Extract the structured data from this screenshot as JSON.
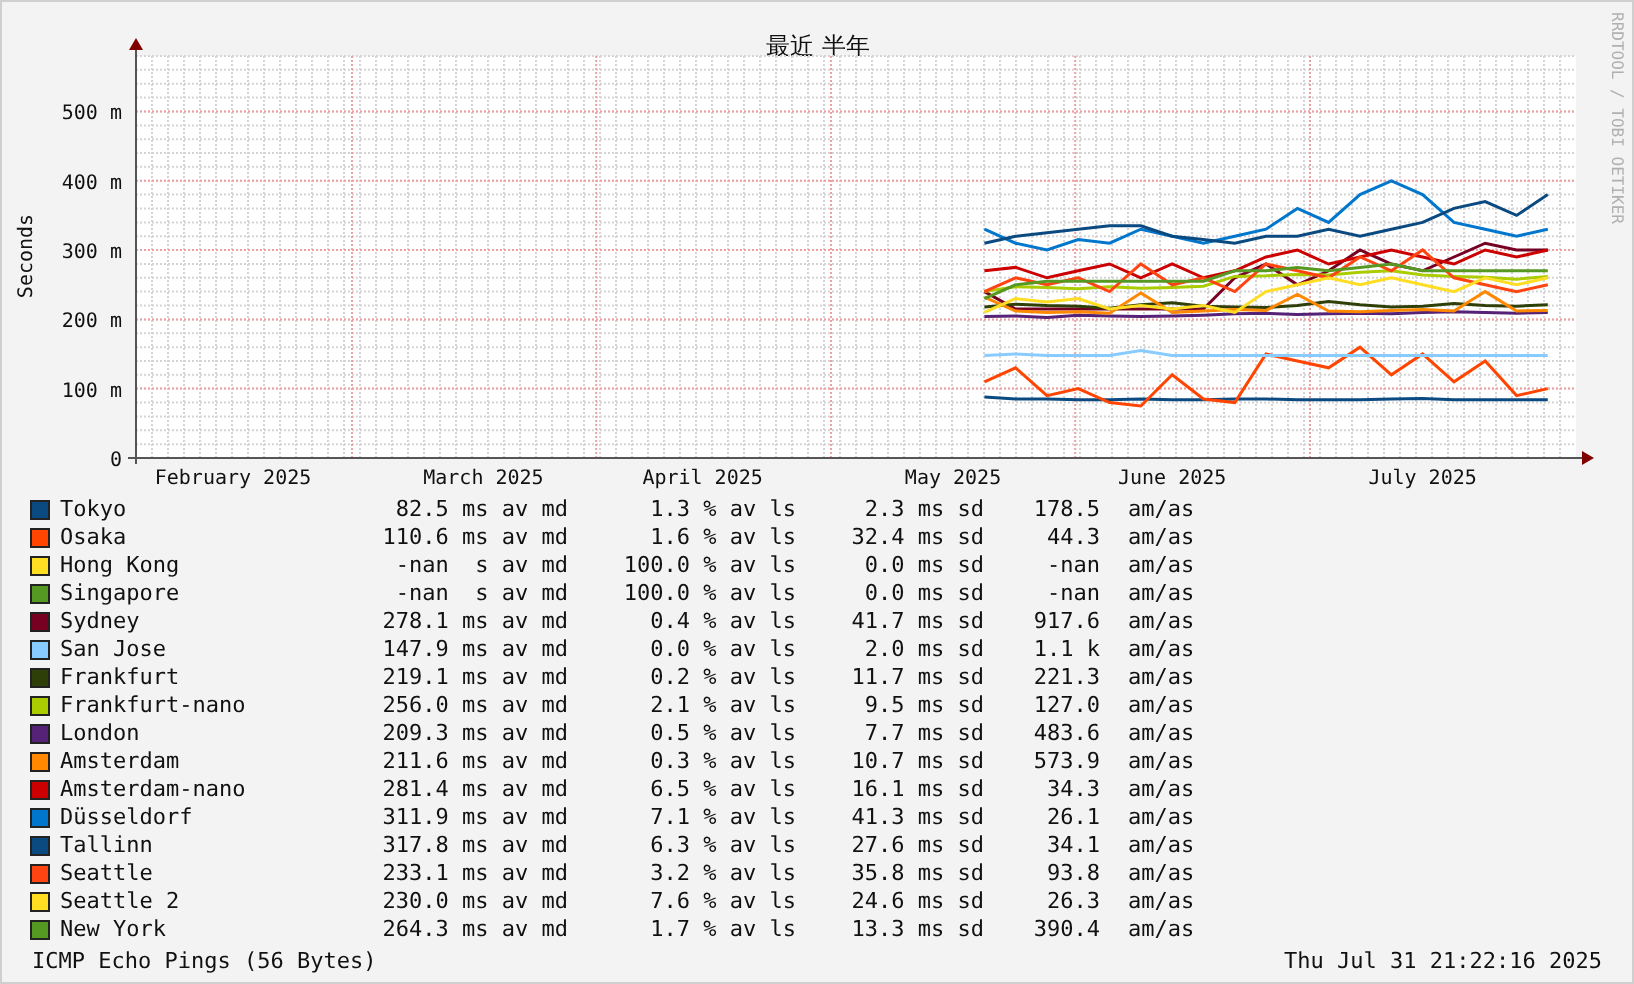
{
  "chart_data": {
    "type": "line",
    "grid": true,
    "title": "最近 半年",
    "ylabel": "Seconds",
    "ylim": [
      0,
      580
    ],
    "categories": [
      null,
      null,
      null,
      "February 2025",
      null,
      null,
      null,
      null,
      null,
      null,
      null,
      "March 2025",
      null,
      null,
      null,
      null,
      null,
      null,
      "April 2025",
      null,
      null,
      null,
      null,
      null,
      null,
      null,
      "May 2025",
      null,
      null,
      null,
      null,
      null,
      null,
      "June 2025",
      null,
      null,
      null,
      null,
      null,
      null,
      null,
      "July 2025",
      null,
      null,
      null,
      null
    ],
    "yticks": [
      {
        "value": 0,
        "label": "0"
      },
      {
        "value": 100,
        "label": "100 m"
      },
      {
        "value": 200,
        "label": "200 m"
      },
      {
        "value": 300,
        "label": "300 m"
      },
      {
        "value": 400,
        "label": "400 m"
      },
      {
        "value": 500,
        "label": "500 m"
      }
    ],
    "series": [
      {
        "name": "Tokyo",
        "color": "#0a4a80",
        "values": [
          null,
          null,
          null,
          null,
          null,
          null,
          null,
          null,
          null,
          null,
          null,
          null,
          null,
          null,
          null,
          null,
          null,
          null,
          null,
          null,
          null,
          null,
          null,
          null,
          null,
          null,
          null,
          88,
          85,
          85,
          84,
          84,
          85,
          84,
          84,
          85,
          85,
          84,
          84,
          84,
          85,
          86,
          84,
          84,
          84,
          84
        ]
      },
      {
        "name": "Osaka",
        "color": "#ff4500",
        "values": [
          null,
          null,
          null,
          null,
          null,
          null,
          null,
          null,
          null,
          null,
          null,
          null,
          null,
          null,
          null,
          null,
          null,
          null,
          null,
          null,
          null,
          null,
          null,
          null,
          null,
          null,
          null,
          110,
          130,
          90,
          100,
          80,
          75,
          120,
          85,
          80,
          150,
          140,
          130,
          160,
          120,
          150,
          110,
          140,
          90,
          100
        ]
      },
      {
        "name": "Hong Kong",
        "color": "#ffdd22",
        "values": [
          null,
          null,
          null,
          null,
          null,
          null,
          null,
          null,
          null,
          null,
          null,
          null,
          null,
          null,
          null,
          null,
          null,
          null,
          null,
          null,
          null,
          null,
          null,
          null,
          null,
          null,
          null,
          null,
          null,
          null,
          null,
          null,
          null,
          null,
          null,
          null,
          null,
          null,
          null,
          null,
          null,
          null,
          null,
          null,
          null,
          null
        ]
      },
      {
        "name": "Singapore",
        "color": "#559922",
        "values": [
          null,
          null,
          null,
          null,
          null,
          null,
          null,
          null,
          null,
          null,
          null,
          null,
          null,
          null,
          null,
          null,
          null,
          null,
          null,
          null,
          null,
          null,
          null,
          null,
          null,
          null,
          null,
          null,
          null,
          null,
          null,
          null,
          null,
          null,
          null,
          null,
          null,
          null,
          null,
          null,
          null,
          null,
          null,
          null,
          null,
          null
        ]
      },
      {
        "name": "Sydney",
        "color": "#770022",
        "values": [
          null,
          null,
          null,
          null,
          null,
          null,
          null,
          null,
          null,
          null,
          null,
          null,
          null,
          null,
          null,
          null,
          null,
          null,
          null,
          null,
          null,
          null,
          null,
          null,
          null,
          null,
          null,
          240,
          215,
          215,
          215,
          215,
          215,
          215,
          215,
          260,
          280,
          250,
          270,
          300,
          280,
          270,
          290,
          310,
          300,
          300
        ]
      },
      {
        "name": "San Jose",
        "color": "#88ccff",
        "values": [
          null,
          null,
          null,
          null,
          null,
          null,
          null,
          null,
          null,
          null,
          null,
          null,
          null,
          null,
          null,
          null,
          null,
          null,
          null,
          null,
          null,
          null,
          null,
          null,
          null,
          null,
          null,
          148,
          150,
          148,
          148,
          148,
          155,
          148,
          148,
          148,
          148,
          148,
          148,
          148,
          148,
          148,
          148,
          148,
          148,
          148
        ]
      },
      {
        "name": "Frankfurt",
        "color": "#2f3f08",
        "values": [
          null,
          null,
          null,
          null,
          null,
          null,
          null,
          null,
          null,
          null,
          null,
          null,
          null,
          null,
          null,
          null,
          null,
          null,
          null,
          null,
          null,
          null,
          null,
          null,
          null,
          null,
          null,
          218,
          222,
          220,
          219,
          216,
          221,
          224,
          219,
          218,
          217,
          220,
          226,
          221,
          218,
          219,
          223,
          220,
          219,
          221
        ]
      },
      {
        "name": "Frankfurt-nano",
        "color": "#aacc00",
        "values": [
          null,
          null,
          null,
          null,
          null,
          null,
          null,
          null,
          null,
          null,
          null,
          null,
          null,
          null,
          null,
          null,
          null,
          null,
          null,
          null,
          null,
          null,
          null,
          null,
          null,
          null,
          null,
          240,
          247,
          246,
          244,
          247,
          245,
          246,
          248,
          262,
          263,
          265,
          264,
          268,
          270,
          264,
          262,
          261,
          258,
          262
        ]
      },
      {
        "name": "London",
        "color": "#552277",
        "values": [
          null,
          null,
          null,
          null,
          null,
          null,
          null,
          null,
          null,
          null,
          null,
          null,
          null,
          null,
          null,
          null,
          null,
          null,
          null,
          null,
          null,
          null,
          null,
          null,
          null,
          null,
          null,
          204,
          205,
          203,
          206,
          205,
          204,
          205,
          206,
          208,
          209,
          207,
          208,
          209,
          208,
          210,
          211,
          210,
          209,
          210
        ]
      },
      {
        "name": "Amsterdam",
        "color": "#ff8800",
        "values": [
          null,
          null,
          null,
          null,
          null,
          null,
          null,
          null,
          null,
          null,
          null,
          null,
          null,
          null,
          null,
          null,
          null,
          null,
          null,
          null,
          null,
          null,
          null,
          null,
          null,
          null,
          null,
          232,
          212,
          210,
          211,
          209,
          238,
          210,
          212,
          214,
          213,
          236,
          212,
          211,
          213,
          214,
          212,
          240,
          212,
          213
        ]
      },
      {
        "name": "Amsterdam-nano",
        "color": "#cc0000",
        "values": [
          null,
          null,
          null,
          null,
          null,
          null,
          null,
          null,
          null,
          null,
          null,
          null,
          null,
          null,
          null,
          null,
          null,
          null,
          null,
          null,
          null,
          null,
          null,
          null,
          null,
          null,
          null,
          270,
          275,
          260,
          270,
          280,
          260,
          280,
          260,
          270,
          290,
          300,
          280,
          290,
          300,
          290,
          280,
          300,
          290,
          300
        ]
      },
      {
        "name": "Düsseldorf",
        "color": "#0077cc",
        "values": [
          null,
          null,
          null,
          null,
          null,
          null,
          null,
          null,
          null,
          null,
          null,
          null,
          null,
          null,
          null,
          null,
          null,
          null,
          null,
          null,
          null,
          null,
          null,
          null,
          null,
          null,
          null,
          330,
          310,
          300,
          315,
          310,
          330,
          320,
          310,
          320,
          330,
          360,
          340,
          380,
          400,
          380,
          340,
          330,
          320,
          330
        ]
      },
      {
        "name": "Tallinn",
        "color": "#0a4a80",
        "values": [
          null,
          null,
          null,
          null,
          null,
          null,
          null,
          null,
          null,
          null,
          null,
          null,
          null,
          null,
          null,
          null,
          null,
          null,
          null,
          null,
          null,
          null,
          null,
          null,
          null,
          null,
          null,
          310,
          320,
          325,
          330,
          335,
          335,
          320,
          315,
          310,
          320,
          320,
          330,
          320,
          330,
          340,
          360,
          370,
          350,
          380
        ]
      },
      {
        "name": "Seattle",
        "color": "#ff4411",
        "values": [
          null,
          null,
          null,
          null,
          null,
          null,
          null,
          null,
          null,
          null,
          null,
          null,
          null,
          null,
          null,
          null,
          null,
          null,
          null,
          null,
          null,
          null,
          null,
          null,
          null,
          null,
          null,
          240,
          260,
          250,
          260,
          240,
          280,
          250,
          260,
          240,
          280,
          270,
          260,
          290,
          270,
          300,
          260,
          250,
          240,
          250
        ]
      },
      {
        "name": "Seattle 2",
        "color": "#ffdd22",
        "values": [
          null,
          null,
          null,
          null,
          null,
          null,
          null,
          null,
          null,
          null,
          null,
          null,
          null,
          null,
          null,
          null,
          null,
          null,
          null,
          null,
          null,
          null,
          null,
          null,
          null,
          null,
          null,
          210,
          230,
          225,
          230,
          215,
          220,
          215,
          220,
          210,
          240,
          250,
          260,
          250,
          260,
          250,
          240,
          260,
          250,
          260
        ]
      },
      {
        "name": "New York",
        "color": "#559922",
        "values": [
          null,
          null,
          null,
          null,
          null,
          null,
          null,
          null,
          null,
          null,
          null,
          null,
          null,
          null,
          null,
          null,
          null,
          null,
          null,
          null,
          null,
          null,
          null,
          null,
          null,
          null,
          null,
          230,
          250,
          255,
          255,
          255,
          255,
          255,
          255,
          270,
          270,
          275,
          270,
          275,
          280,
          270,
          270,
          270,
          270,
          270
        ]
      }
    ]
  },
  "credit": "RRDTOOL / TOBI OETIKER",
  "legend": [
    {
      "median": "82.5 ms av md",
      "loss": "1.3 % av ls",
      "sd": "2.3 ms sd",
      "amas": "178.5",
      "unit": "am/as"
    },
    {
      "median": "110.6 ms av md",
      "loss": "1.6 % av ls",
      "sd": "32.4 ms sd",
      "amas": "44.3",
      "unit": "am/as"
    },
    {
      "median": "-nan  s av md",
      "loss": "100.0 % av ls",
      "sd": "0.0 ms sd",
      "amas": "-nan",
      "unit": "am/as"
    },
    {
      "median": "-nan  s av md",
      "loss": "100.0 % av ls",
      "sd": "0.0 ms sd",
      "amas": "-nan",
      "unit": "am/as"
    },
    {
      "median": "278.1 ms av md",
      "loss": "0.4 % av ls",
      "sd": "41.7 ms sd",
      "amas": "917.6",
      "unit": "am/as"
    },
    {
      "median": "147.9 ms av md",
      "loss": "0.0 % av ls",
      "sd": "2.0 ms sd",
      "amas": "1.1 k",
      "unit": "am/as"
    },
    {
      "median": "219.1 ms av md",
      "loss": "0.2 % av ls",
      "sd": "11.7 ms sd",
      "amas": "221.3",
      "unit": "am/as"
    },
    {
      "median": "256.0 ms av md",
      "loss": "2.1 % av ls",
      "sd": "9.5 ms sd",
      "amas": "127.0",
      "unit": "am/as"
    },
    {
      "median": "209.3 ms av md",
      "loss": "0.5 % av ls",
      "sd": "7.7 ms sd",
      "amas": "483.6",
      "unit": "am/as"
    },
    {
      "median": "211.6 ms av md",
      "loss": "0.3 % av ls",
      "sd": "10.7 ms sd",
      "amas": "573.9",
      "unit": "am/as"
    },
    {
      "median": "281.4 ms av md",
      "loss": "6.5 % av ls",
      "sd": "16.1 ms sd",
      "amas": "34.3",
      "unit": "am/as"
    },
    {
      "median": "311.9 ms av md",
      "loss": "7.1 % av ls",
      "sd": "41.3 ms sd",
      "amas": "26.1",
      "unit": "am/as"
    },
    {
      "median": "317.8 ms av md",
      "loss": "6.3 % av ls",
      "sd": "27.6 ms sd",
      "amas": "34.1",
      "unit": "am/as"
    },
    {
      "median": "233.1 ms av md",
      "loss": "3.2 % av ls",
      "sd": "35.8 ms sd",
      "amas": "93.8",
      "unit": "am/as"
    },
    {
      "median": "230.0 ms av md",
      "loss": "7.6 % av ls",
      "sd": "24.6 ms sd",
      "amas": "26.3",
      "unit": "am/as"
    },
    {
      "median": "264.3 ms av md",
      "loss": "1.7 % av ls",
      "sd": "13.3 ms sd",
      "amas": "390.4",
      "unit": "am/as"
    }
  ],
  "footer": {
    "caption": "ICMP Echo Pings (56 Bytes)",
    "timestamp": "Thu Jul 31 21:22:16 2025"
  }
}
